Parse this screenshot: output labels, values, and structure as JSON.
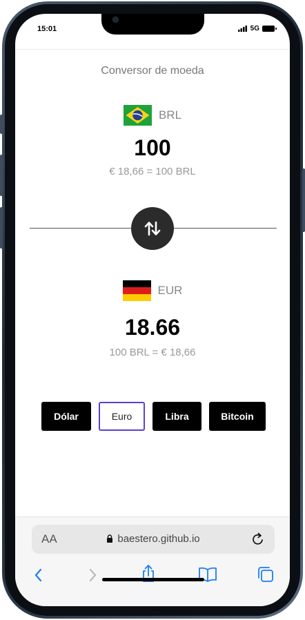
{
  "status_bar": {
    "time": "15:01",
    "network": "5G"
  },
  "app": {
    "title": "Conversor de moeda"
  },
  "source": {
    "code": "BRL",
    "flag": "brazil-flag",
    "value": "100",
    "rate": "€ 18,66 = 100 BRL"
  },
  "target": {
    "code": "EUR",
    "flag": "germany-flag",
    "value": "18.66",
    "rate": "100 BRL = € 18,66"
  },
  "currency_buttons": [
    {
      "label": "Dólar",
      "selected": false
    },
    {
      "label": "Euro",
      "selected": true
    },
    {
      "label": "Libra",
      "selected": false
    },
    {
      "label": "Bitcoin",
      "selected": false
    }
  ],
  "browser": {
    "aa_label": "AA",
    "url": "baestero.github.io"
  },
  "colors": {
    "accent": "#5b3fd1",
    "button_dark": "#000000",
    "swap_button": "#2b2b2b",
    "ios_blue": "#1a7cf5"
  }
}
